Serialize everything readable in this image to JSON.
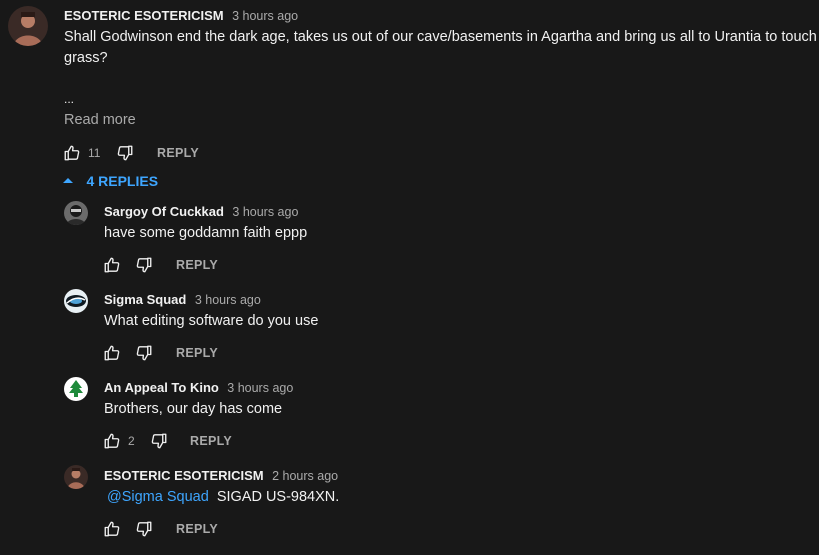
{
  "top_comment": {
    "author": "ESOTERIC ESOTERICISM",
    "time": "3 hours ago",
    "text_line1": "Shall Godwinson end the dark age, takes us out of our cave/basements in Agartha  and bring us all to Urantia to touch",
    "text_line2": "grass?",
    "ellipsis": "...",
    "read_more": "Read more",
    "likes": "11",
    "reply_label": "REPLY",
    "replies_toggle": "4 REPLIES"
  },
  "replies": [
    {
      "author": "Sargoy Of Cuckkad",
      "time": "3 hours ago",
      "text": "have some goddamn faith eppp",
      "likes": "",
      "reply_label": "REPLY"
    },
    {
      "author": "Sigma Squad",
      "time": "3 hours ago",
      "text": "What editing software do you use",
      "likes": "",
      "reply_label": "REPLY"
    },
    {
      "author": "An Appeal To Kino",
      "time": "3 hours ago",
      "text": "Brothers, our day has come",
      "likes": "2",
      "reply_label": "REPLY"
    },
    {
      "author": "ESOTERIC ESOTERICISM",
      "time": "2 hours ago",
      "mention": "@Sigma Squad",
      "text": "SIGAD US-984XN.",
      "likes": "",
      "reply_label": "REPLY"
    }
  ],
  "colors": {
    "background": "#181818",
    "link_blue": "#3ea6ff",
    "muted_text": "#aaaaaa"
  },
  "icons": [
    "thumb-up-icon",
    "thumb-down-icon",
    "chevron-up-icon",
    "avatar"
  ]
}
